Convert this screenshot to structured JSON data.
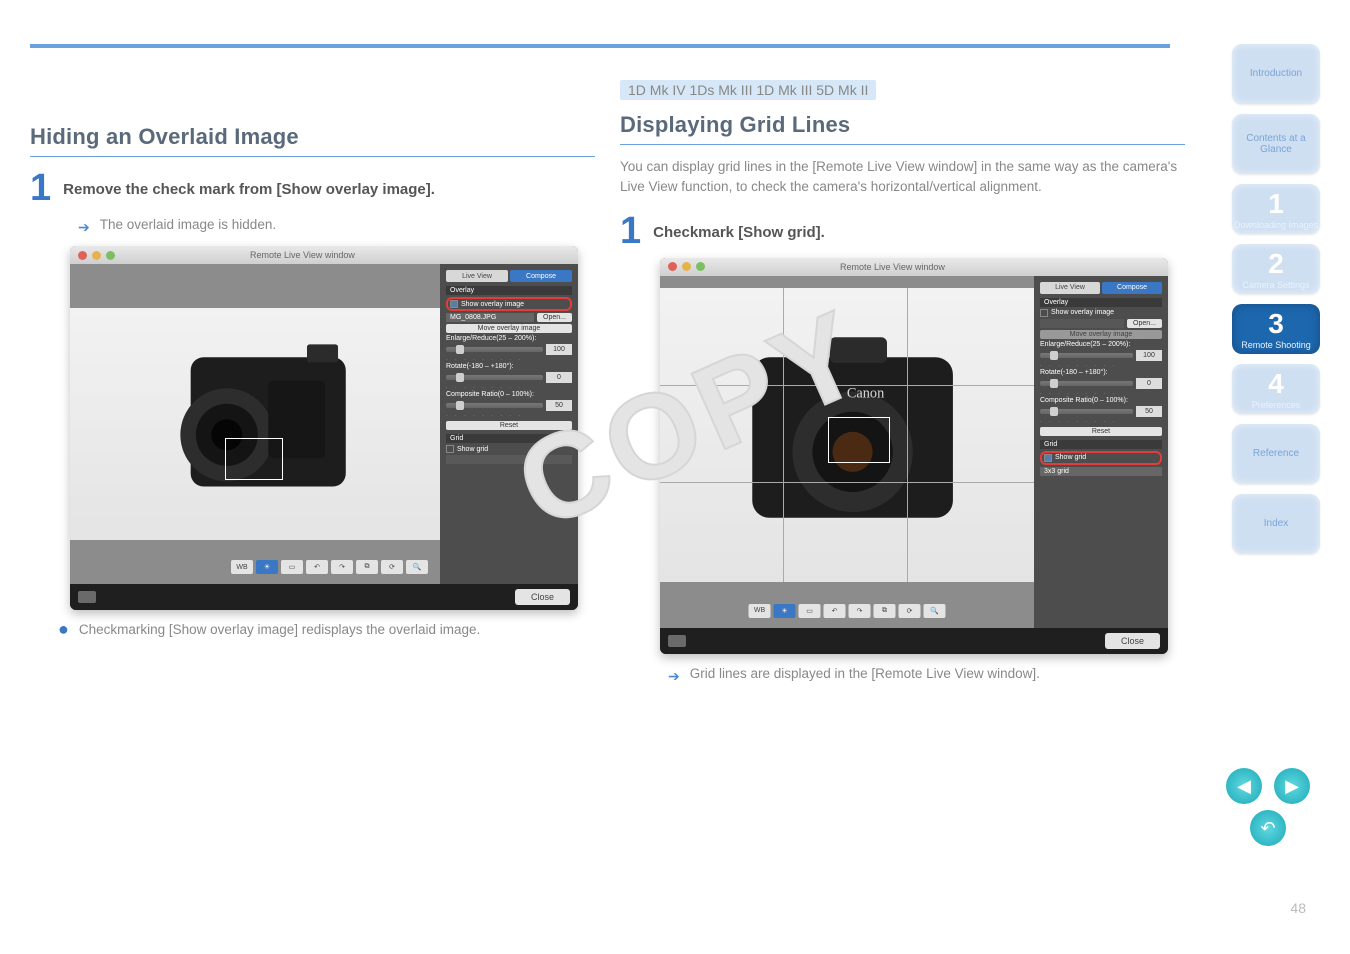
{
  "page_number": "48",
  "top_highlight": "1D Mk IV 1Ds Mk III 1D Mk III 5D Mk II",
  "copy_stamp": "COPY",
  "left": {
    "title": "Hiding an Overlaid Image",
    "step_number": "1",
    "step_text": "Remove the check mark from [Show overlay image].",
    "arrow_note": "The overlaid image is hidden.",
    "bullet_note": "Checkmarking [Show overlay image] redisplays the overlaid image."
  },
  "right": {
    "title": "Displaying Grid Lines",
    "intro": "You can display grid lines in the [Remote Live View window] in the same way as the camera's Live View function, to check the camera's horizontal/vertical alignment.",
    "step_number": "1",
    "step_text": "Checkmark [Show grid].",
    "arrow_note": "Grid lines are displayed in the [Remote Live View window]."
  },
  "window": {
    "title": "Remote Live View window",
    "tab_live": "Live View",
    "tab_compose": "Compose",
    "overlay_label": "Overlay",
    "show_overlay": "Show overlay image",
    "open_btn": "Open...",
    "file_field": "MG_0808.JPG",
    "move_overlay": "Move overlay image",
    "enlarge": "Enlarge/Reduce(25 – 200%):",
    "enlarge_val": "100",
    "rotate": "Rotate(-180 – +180°):",
    "rotate_val": "0",
    "comp_ratio": "Composite Ratio(0 – 100%):",
    "comp_val": "50",
    "reset": "Reset",
    "grid_label": "Grid",
    "show_grid": "Show grid",
    "grid_select": "3x3 grid",
    "close": "Close"
  },
  "nav": {
    "intro": "Introduction",
    "contents": "Contents at a Glance",
    "n1": {
      "num": "1",
      "label": "Downloading Images"
    },
    "n2": {
      "num": "2",
      "label": "Camera Settings"
    },
    "n3": {
      "num": "3",
      "label": "Remote Shooting"
    },
    "n4": {
      "num": "4",
      "label": "Preferences"
    },
    "ref": "Reference",
    "index": "Index"
  }
}
